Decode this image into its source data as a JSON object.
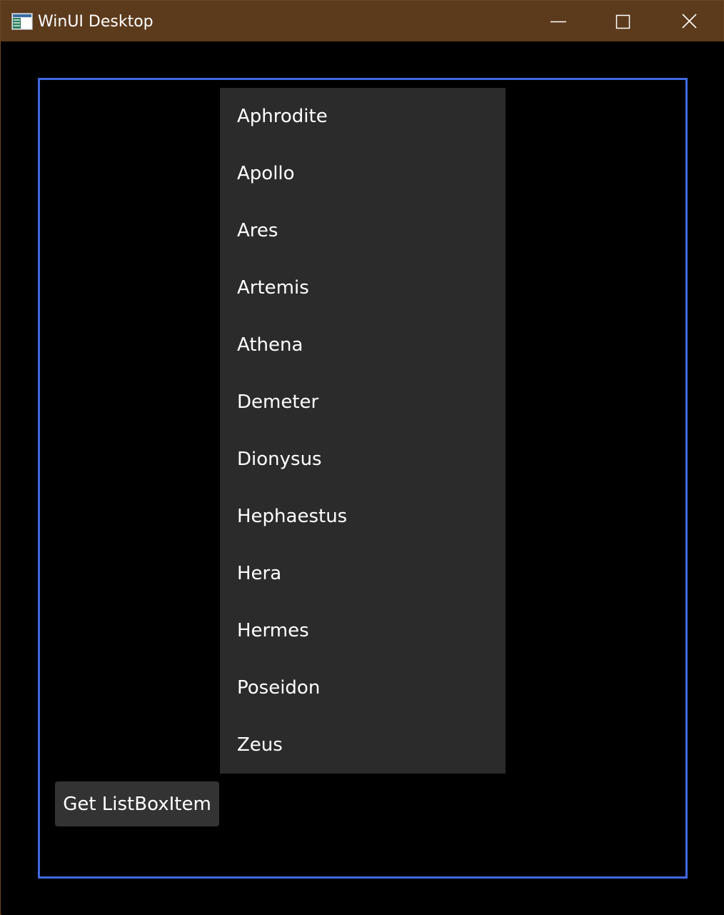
{
  "window": {
    "title": "WinUI Desktop",
    "titlebar_color": "#5c3a1c",
    "background_color": "#000000",
    "icons": {
      "app": "app-icon",
      "minimize": "minimize-icon",
      "maximize": "maximize-icon",
      "close": "close-icon"
    }
  },
  "content": {
    "border_color": "#4169e1",
    "listbox": {
      "background_color": "#2b2b2b",
      "items": [
        "Aphrodite",
        "Apollo",
        "Ares",
        "Artemis",
        "Athena",
        "Demeter",
        "Dionysus",
        "Hephaestus",
        "Hera",
        "Hermes",
        "Poseidon",
        "Zeus"
      ]
    },
    "button": {
      "label": "Get ListBoxItem",
      "background_color": "#333333"
    }
  }
}
